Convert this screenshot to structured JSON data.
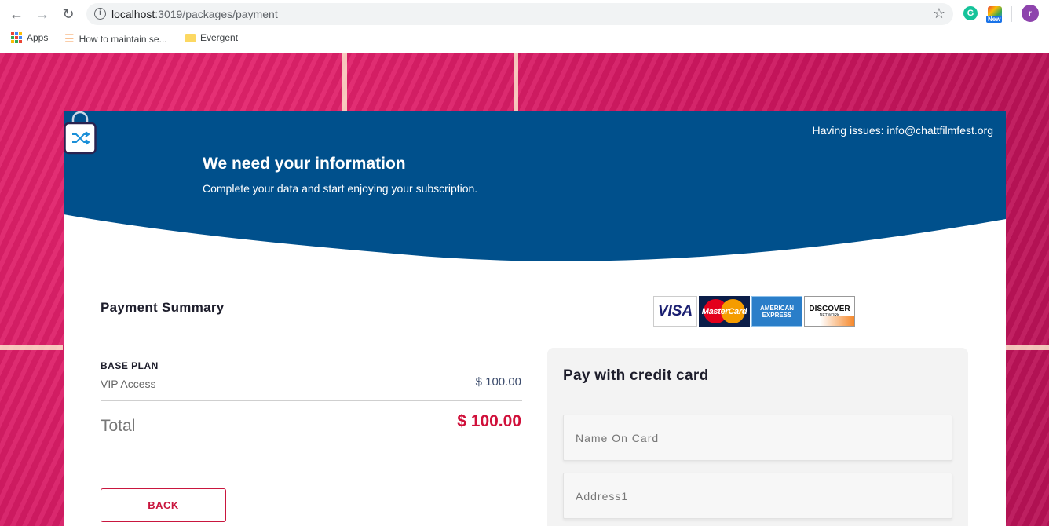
{
  "browser": {
    "url_host": "localhost",
    "url_rest": ":3019/packages/payment",
    "bookmarks": [
      {
        "label": "Apps"
      },
      {
        "label": "How to maintain se..."
      },
      {
        "label": "Evergent"
      }
    ],
    "profile_initial": "r",
    "new_badge": "New"
  },
  "header": {
    "issues": "Having issues: info@chattfilmfest.org",
    "title": "We need your information",
    "subtitle": "Complete your data and start enjoying your subscription."
  },
  "summary": {
    "title": "Payment Summary",
    "plan_label": "BASE PLAN",
    "plan_name": "VIP Access",
    "plan_price": "$ 100.00",
    "total_label": "Total",
    "total_value": "$ 100.00",
    "back_label": "BACK"
  },
  "card_logos": {
    "visa": "VISA",
    "mastercard": "MasterCard",
    "amex_line1": "AMERICAN",
    "amex_line2": "EXPRESS",
    "discover": "DISCOVER",
    "discover_sub": "NETWORK"
  },
  "payment": {
    "title": "Pay with credit card",
    "name_placeholder": "Name On Card",
    "address_placeholder": "Address1"
  },
  "colors": {
    "header_blue": "#00508c",
    "accent_red": "#d0103a",
    "background_pink": "#d81b66"
  }
}
